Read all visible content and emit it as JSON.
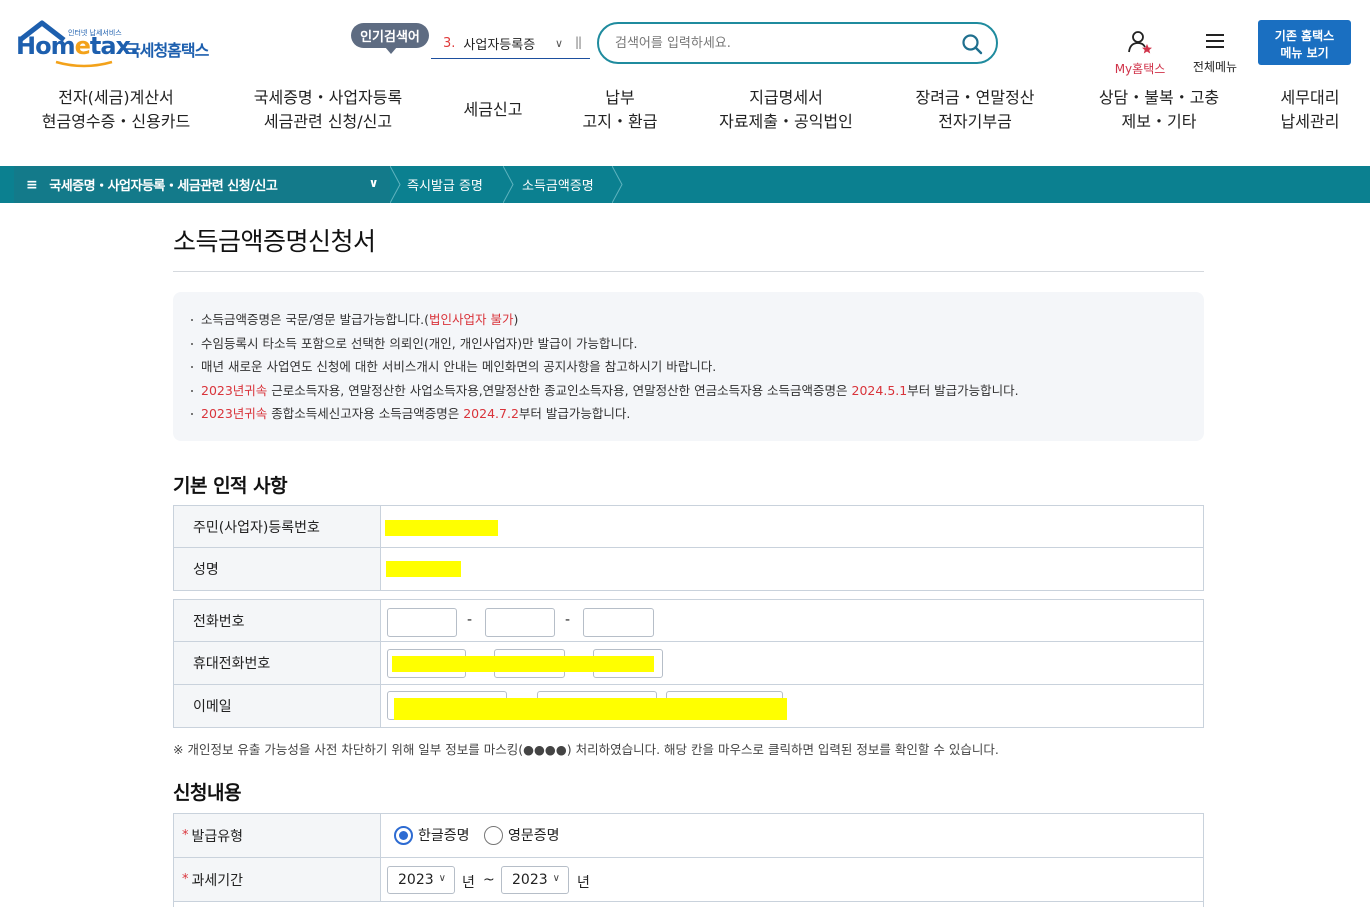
{
  "header": {
    "logo_tag": "인터넷 납세서비스",
    "logo_home": "Hom",
    "logo_e": "e",
    "logo_tax": "tax.",
    "logo_sub": "국세청홈택스",
    "popular_badge": "인기검색어",
    "popular_rank": "3.",
    "popular_term": "사업자등록증",
    "search_placeholder": "검색어를 입력하세요.",
    "my_hometax": "My홈택스",
    "all_menu": "전체메뉴",
    "legacy_line1": "기존 홈택스",
    "legacy_line2": "메뉴 보기"
  },
  "gnb": [
    {
      "line1": "전자(세금)계산서",
      "line2": "현금영수증・신용카드"
    },
    {
      "line1": "국세증명・사업자등록",
      "line2": "세금관련 신청/신고"
    },
    {
      "line1": "세금신고",
      "line2": ""
    },
    {
      "line1": "납부",
      "line2": "고지・환급"
    },
    {
      "line1": "지급명세서",
      "line2": "자료제출・공익법인"
    },
    {
      "line1": "장려금・연말정산",
      "line2": "전자기부금"
    },
    {
      "line1": "상담・불복・고충",
      "line2": "제보・기타"
    },
    {
      "line1": "세무대리",
      "line2": "납세관리"
    }
  ],
  "breadcrumb": {
    "root": "국세증명・사업자등록・세금관련 신청/신고",
    "items": [
      "즉시발급 증명",
      "소득금액증명"
    ]
  },
  "page": {
    "title": "소득금액증명신청서"
  },
  "notice": {
    "l1_a": "소득금액증명은 국문/영문 발급가능합니다.(",
    "l1_red": "법인사업자 불가",
    "l1_b": ")",
    "l2": "수임등록시 타소득 포함으로 선택한 의뢰인(개인, 개인사업자)만 발급이 가능합니다.",
    "l3": "매년 새로운 사업연도 신청에 대한 서비스개시 안내는 메인화면의 공지사항을 참고하시기 바랍니다.",
    "l4_red1": "2023년귀속",
    "l4_a": " 근로소득자용, 연말정산한 사업소득자용,연말정산한 종교인소득자용, 연말정산한 연금소득자용 소득금액증명은 ",
    "l4_red2": "2024.5.1",
    "l4_b": "부터 발급가능합니다.",
    "l5_red1": "2023년귀속",
    "l5_a": " 종합소득세신고자용 소득금액증명은 ",
    "l5_red2": "2024.7.2",
    "l5_b": "부터 발급가능합니다."
  },
  "basic": {
    "title": "기본 인적 사항",
    "rrn_label": "주민(사업자)등록번호",
    "name_label": "성명",
    "phone_label": "전화번호",
    "mobile_label": "휴대전화번호",
    "email_label": "이메일",
    "dash": "-"
  },
  "privacy_note": "※ 개인정보 유출 가능성을 사전 차단하기 위해 일부 정보를 마스킹(●●●●) 처리하였습니다. 해당 칸을 마우스로 클릭하면 입력된 정보를 확인할 수 있습니다.",
  "request": {
    "title": "신청내용",
    "req_mark": "*",
    "type_label": "발급유형",
    "type_korean": "한글증명",
    "type_english": "영문증명",
    "period_label": "과세기간",
    "year_from": "2023",
    "year_to": "2023",
    "year_unit": "년",
    "tilde": "~"
  },
  "colors": {
    "primary": "#0b8090",
    "brand_blue": "#1d5fae",
    "accent_red": "#d9343b",
    "mask_yellow": "#ffff00"
  }
}
